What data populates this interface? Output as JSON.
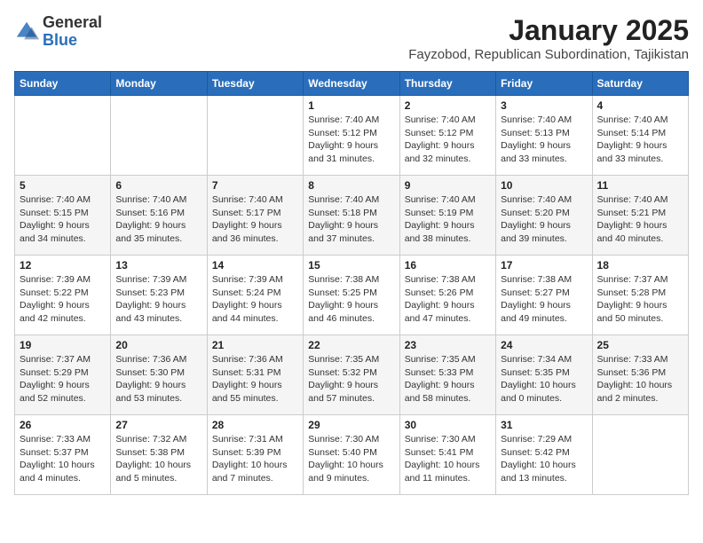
{
  "header": {
    "logo_general": "General",
    "logo_blue": "Blue",
    "title": "January 2025",
    "location": "Fayzobod, Republican Subordination, Tajikistan"
  },
  "weekdays": [
    "Sunday",
    "Monday",
    "Tuesday",
    "Wednesday",
    "Thursday",
    "Friday",
    "Saturday"
  ],
  "weeks": [
    [
      {
        "day": "",
        "info": ""
      },
      {
        "day": "",
        "info": ""
      },
      {
        "day": "",
        "info": ""
      },
      {
        "day": "1",
        "info": "Sunrise: 7:40 AM\nSunset: 5:12 PM\nDaylight: 9 hours and 31 minutes."
      },
      {
        "day": "2",
        "info": "Sunrise: 7:40 AM\nSunset: 5:12 PM\nDaylight: 9 hours and 32 minutes."
      },
      {
        "day": "3",
        "info": "Sunrise: 7:40 AM\nSunset: 5:13 PM\nDaylight: 9 hours and 33 minutes."
      },
      {
        "day": "4",
        "info": "Sunrise: 7:40 AM\nSunset: 5:14 PM\nDaylight: 9 hours and 33 minutes."
      }
    ],
    [
      {
        "day": "5",
        "info": "Sunrise: 7:40 AM\nSunset: 5:15 PM\nDaylight: 9 hours and 34 minutes."
      },
      {
        "day": "6",
        "info": "Sunrise: 7:40 AM\nSunset: 5:16 PM\nDaylight: 9 hours and 35 minutes."
      },
      {
        "day": "7",
        "info": "Sunrise: 7:40 AM\nSunset: 5:17 PM\nDaylight: 9 hours and 36 minutes."
      },
      {
        "day": "8",
        "info": "Sunrise: 7:40 AM\nSunset: 5:18 PM\nDaylight: 9 hours and 37 minutes."
      },
      {
        "day": "9",
        "info": "Sunrise: 7:40 AM\nSunset: 5:19 PM\nDaylight: 9 hours and 38 minutes."
      },
      {
        "day": "10",
        "info": "Sunrise: 7:40 AM\nSunset: 5:20 PM\nDaylight: 9 hours and 39 minutes."
      },
      {
        "day": "11",
        "info": "Sunrise: 7:40 AM\nSunset: 5:21 PM\nDaylight: 9 hours and 40 minutes."
      }
    ],
    [
      {
        "day": "12",
        "info": "Sunrise: 7:39 AM\nSunset: 5:22 PM\nDaylight: 9 hours and 42 minutes."
      },
      {
        "day": "13",
        "info": "Sunrise: 7:39 AM\nSunset: 5:23 PM\nDaylight: 9 hours and 43 minutes."
      },
      {
        "day": "14",
        "info": "Sunrise: 7:39 AM\nSunset: 5:24 PM\nDaylight: 9 hours and 44 minutes."
      },
      {
        "day": "15",
        "info": "Sunrise: 7:38 AM\nSunset: 5:25 PM\nDaylight: 9 hours and 46 minutes."
      },
      {
        "day": "16",
        "info": "Sunrise: 7:38 AM\nSunset: 5:26 PM\nDaylight: 9 hours and 47 minutes."
      },
      {
        "day": "17",
        "info": "Sunrise: 7:38 AM\nSunset: 5:27 PM\nDaylight: 9 hours and 49 minutes."
      },
      {
        "day": "18",
        "info": "Sunrise: 7:37 AM\nSunset: 5:28 PM\nDaylight: 9 hours and 50 minutes."
      }
    ],
    [
      {
        "day": "19",
        "info": "Sunrise: 7:37 AM\nSunset: 5:29 PM\nDaylight: 9 hours and 52 minutes."
      },
      {
        "day": "20",
        "info": "Sunrise: 7:36 AM\nSunset: 5:30 PM\nDaylight: 9 hours and 53 minutes."
      },
      {
        "day": "21",
        "info": "Sunrise: 7:36 AM\nSunset: 5:31 PM\nDaylight: 9 hours and 55 minutes."
      },
      {
        "day": "22",
        "info": "Sunrise: 7:35 AM\nSunset: 5:32 PM\nDaylight: 9 hours and 57 minutes."
      },
      {
        "day": "23",
        "info": "Sunrise: 7:35 AM\nSunset: 5:33 PM\nDaylight: 9 hours and 58 minutes."
      },
      {
        "day": "24",
        "info": "Sunrise: 7:34 AM\nSunset: 5:35 PM\nDaylight: 10 hours and 0 minutes."
      },
      {
        "day": "25",
        "info": "Sunrise: 7:33 AM\nSunset: 5:36 PM\nDaylight: 10 hours and 2 minutes."
      }
    ],
    [
      {
        "day": "26",
        "info": "Sunrise: 7:33 AM\nSunset: 5:37 PM\nDaylight: 10 hours and 4 minutes."
      },
      {
        "day": "27",
        "info": "Sunrise: 7:32 AM\nSunset: 5:38 PM\nDaylight: 10 hours and 5 minutes."
      },
      {
        "day": "28",
        "info": "Sunrise: 7:31 AM\nSunset: 5:39 PM\nDaylight: 10 hours and 7 minutes."
      },
      {
        "day": "29",
        "info": "Sunrise: 7:30 AM\nSunset: 5:40 PM\nDaylight: 10 hours and 9 minutes."
      },
      {
        "day": "30",
        "info": "Sunrise: 7:30 AM\nSunset: 5:41 PM\nDaylight: 10 hours and 11 minutes."
      },
      {
        "day": "31",
        "info": "Sunrise: 7:29 AM\nSunset: 5:42 PM\nDaylight: 10 hours and 13 minutes."
      },
      {
        "day": "",
        "info": ""
      }
    ]
  ]
}
